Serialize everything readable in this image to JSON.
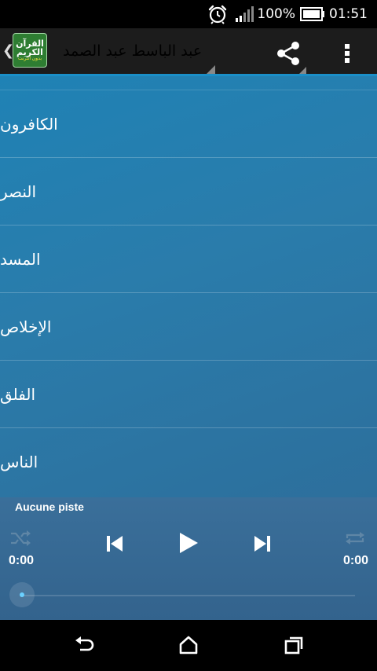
{
  "status_bar": {
    "time": "01:51",
    "battery_percent": "100%",
    "icons": [
      "alarm-icon",
      "signal-icon",
      "battery-icon"
    ]
  },
  "action_bar": {
    "app_logo": {
      "line1": "القرآن",
      "line2": "الكريم",
      "line3": "بدون انترنت"
    },
    "title": "عبد الباسط عبد الصمد",
    "icons": [
      "up-chevron-icon",
      "share-icon",
      "overflow-menu-icon"
    ]
  },
  "surah_list": [
    {
      "label": "الكافرون"
    },
    {
      "label": "النصر"
    },
    {
      "label": "المسد"
    },
    {
      "label": "الإخلاص"
    },
    {
      "label": "الفلق"
    },
    {
      "label": "الناس"
    }
  ],
  "player": {
    "track_title": "Aucune piste",
    "elapsed": "0:00",
    "duration": "0:00",
    "progress": 0
  },
  "nav_bar": {
    "icons": [
      "back-icon",
      "home-icon",
      "recents-icon"
    ]
  },
  "colors": {
    "accent": "#1a8fc8",
    "list_bg": "#2a7cab",
    "player_bg": "#3a6f9a",
    "seek_dot": "#6ad0ff"
  }
}
